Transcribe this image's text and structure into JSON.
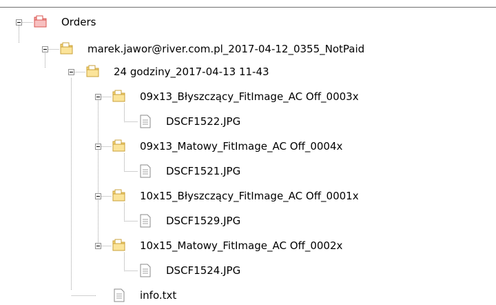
{
  "tree": {
    "root": {
      "label": "Orders",
      "icon": "red-folder-icon",
      "children": {
        "order": {
          "label": "marek.jawor@river.com.pl_2017-04-12_0355_NotPaid",
          "icon": "folder-icon",
          "children": {
            "batch": {
              "label": "24 godziny_2017-04-13 11-43",
              "icon": "folder-icon",
              "groups": [
                {
                  "label": "09x13_Błyszczący_FitImage_AC Off_0003x",
                  "file": "DSCF1522.JPG"
                },
                {
                  "label": "09x13_Matowy_FitImage_AC Off_0004x",
                  "file": "DSCF1521.JPG"
                },
                {
                  "label": "10x15_Błyszczący_FitImage_AC Off_0001x",
                  "file": "DSCF1529.JPG"
                },
                {
                  "label": "10x15_Matowy_FitImage_AC Off_0002x",
                  "file": "DSCF1524.JPG"
                }
              ]
            },
            "info_file": "info.txt"
          }
        }
      }
    }
  },
  "colors": {
    "connector": "#a0a0a0",
    "folder_fill": "#f8d775",
    "folder_dark": "#e0b44a",
    "red_folder_fill": "#f4a5a5",
    "red_folder_dark": "#d9534f",
    "file_fill": "#ffffff",
    "file_border": "#8a8a8a"
  }
}
